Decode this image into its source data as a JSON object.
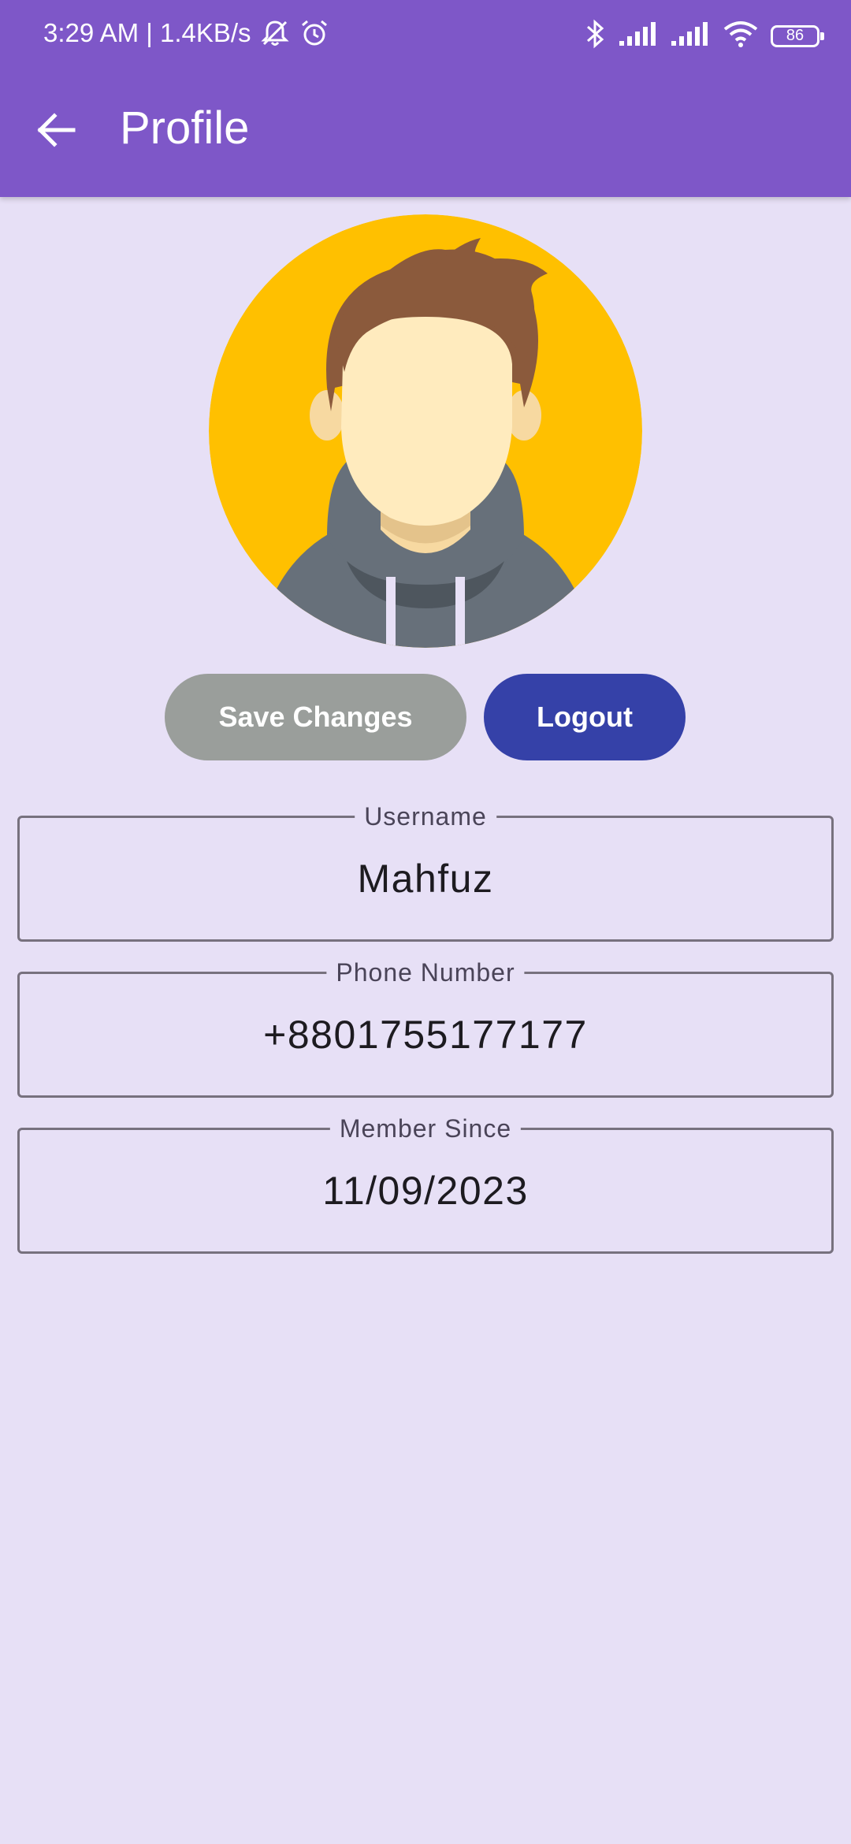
{
  "status_bar": {
    "time_speed": "3:29 AM | 1.4KB/s",
    "battery_level": "86",
    "icons": [
      "muted-bell-icon",
      "alarm-icon",
      "bluetooth-icon",
      "signal-icon",
      "signal-icon",
      "wifi-icon",
      "battery-icon"
    ]
  },
  "app_bar": {
    "title": "Profile",
    "back_icon": "arrow-back-icon",
    "background_color": "#7E57C8"
  },
  "profile": {
    "avatar_icon": "avatar-illustration"
  },
  "actions": {
    "save_label": "Save Changes",
    "logout_label": "Logout",
    "save_color": "#9A9E9B",
    "logout_color": "#3541A8"
  },
  "fields": {
    "username": {
      "label": "Username",
      "value": "Mahfuz"
    },
    "phone": {
      "label": "Phone Number",
      "value": "+8801755177177"
    },
    "member_since": {
      "label": "Member Since",
      "value": "11/09/2023"
    }
  },
  "colors": {
    "page_background": "#E7E0F6",
    "field_border": "#77717E"
  }
}
